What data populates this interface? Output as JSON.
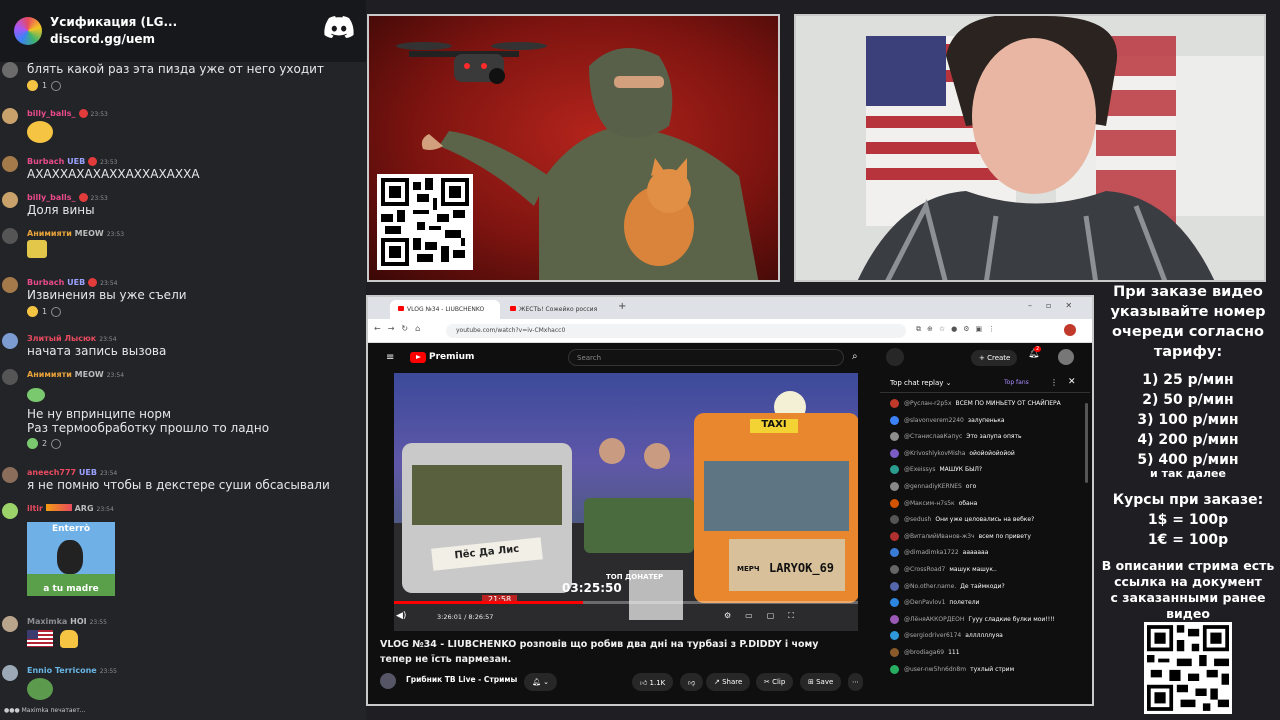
{
  "header": {
    "title": "Усификация (LG...",
    "invite": "discord.gg/uem"
  },
  "messages": [
    {
      "text": "блять какой раз эта пизда уже от него уходит",
      "reaction": "1"
    },
    {
      "name": "billy_balls_",
      "time": "23:53"
    },
    {
      "name": "Burbach",
      "badge": "UEB",
      "time": "23:53",
      "text": "АХАХХАХАХАХХАХХАХАХХА"
    },
    {
      "name": "billy_balls_",
      "time": "23:53",
      "text": "Доля вины"
    },
    {
      "name": "Анимияти",
      "badge": "MEOW",
      "time": "23:53"
    },
    {
      "name": "Burbach",
      "badge": "UEB",
      "time": "23:54",
      "text": "Извинения вы уже съели",
      "reaction": "1"
    },
    {
      "name": "Злитый Лысюк",
      "time": "23:54",
      "text": "начата запись вызова"
    },
    {
      "name": "Анимияти",
      "badge": "MEOW",
      "time": "23:54",
      "line1": "Не ну впринципе норм",
      "line2": "Раз термообработку прошло то ладно",
      "reaction": "2"
    },
    {
      "name": "aneech777",
      "badge": "UEB",
      "time": "23:54",
      "text": "я не помню чтобы в декстере суши обсасывали"
    },
    {
      "name": "iltir",
      "badge": "ARG",
      "time": "23:54",
      "sticker_top": "Enterrò",
      "sticker_bottom": "a tu madre"
    },
    {
      "name": "Maximka",
      "badge": "HOI",
      "time": "23:55"
    },
    {
      "name": "Ennio Terricone",
      "time": "23:55"
    }
  ],
  "typing": "Maximka печатает...",
  "browser": {
    "tab1": "VLOG №34 - LIUBCHENKO",
    "tab2": "ЖЕСТЬ! Сожейко россия",
    "url": "youtube.com/watch?v=iv-CMxhacc0",
    "logo": "Premium",
    "search": "Search",
    "create": "Create",
    "notif": "2",
    "video_title": "VLOG №34 - LIUBCHENKO розповів що робив два дні на турбазі з P.DIDDY і чому тепер не їсть пармезан.",
    "channel": "Грибник ТВ Live - Стримы",
    "likes": "1.1K",
    "share": "Share",
    "clip": "Clip",
    "save": "Save",
    "time": "3:26:01 / 8:26:57",
    "overlay_time": "03:25:50",
    "overlay_label": "ТОП ДОНАТЕР",
    "overlay_small": "21:58",
    "sign_text": "Пёс Да Лис",
    "merch": "МЕРЧ",
    "merch_handle": "LARYOK_69",
    "taxi": "TAXI"
  },
  "livechat": {
    "title": "Top chat replay",
    "fans": "Top fans",
    "rows": [
      {
        "name": "@Руслан-r2p5x",
        "text": "ВСЕМ ПО МИНЬЕТУ ОТ СНАЙПЕРА",
        "color": "#c0392b"
      },
      {
        "name": "@slavonverem2240",
        "text": "залупенька",
        "color": "#3b82f6"
      },
      {
        "name": "@СтаниславКапус",
        "text": "Это залупа опять",
        "color": "#8e8e8e"
      },
      {
        "name": "@KrivoshlykovMisha",
        "text": "ойойойойойой",
        "color": "#7a5cc2"
      },
      {
        "name": "@Exeissys",
        "text": "МАШУК БЫЛ?",
        "color": "#2a9d8f"
      },
      {
        "name": "@gennadiyKERNES",
        "text": "ого",
        "color": "#888"
      },
      {
        "name": "@Максим-н7s5к",
        "text": "обана",
        "color": "#d35400"
      },
      {
        "name": "@sedush",
        "text": "Они уже целовались на вебке?",
        "color": "#555"
      },
      {
        "name": "@ВиталийИванов-ж3ч",
        "text": "всем по привету",
        "color": "#b03030"
      },
      {
        "name": "@dimadimka1722",
        "text": "ааааааа",
        "color": "#3a7bd5"
      },
      {
        "name": "@CrossRoad7",
        "text": "машук машук..",
        "color": "#666"
      },
      {
        "name": "@No.other.name.",
        "text": "Де таймкоди?",
        "color": "#5566aa"
      },
      {
        "name": "@DenPavlov1",
        "text": "полетели",
        "color": "#2e86de"
      },
      {
        "name": "@ЛёняАККОРДЕОН",
        "text": "Гууу сладкие булки мои!!!!",
        "color": "#9b59b6"
      },
      {
        "name": "@sergiodriver6174",
        "text": "аллллллуяа",
        "color": "#2d98da"
      },
      {
        "name": "@brodiaga69",
        "text": "111",
        "color": "#8b5a2b"
      },
      {
        "name": "@user-nw5hn6dn8m",
        "text": "тухлый стрим",
        "color": "#27ae60"
      }
    ]
  },
  "sidebar": {
    "pricing_lines": [
      "При заказе видео",
      "указывайте номер",
      "очереди согласно",
      "тарифу:"
    ],
    "tiers": [
      "1) 25 р/мин",
      "2) 50 р/мин",
      "3) 100 р/мин",
      "4) 200 р/мин",
      "5) 400 р/мин"
    ],
    "tiers_more": "и так далее",
    "rates_title": "Курсы при заказе:",
    "rates": [
      "1$ = 100р",
      "1€ = 100р"
    ],
    "desc_lines": [
      "В описании стрима есть",
      "ссылка на документ",
      "с заказанными ранее",
      "видео"
    ]
  }
}
